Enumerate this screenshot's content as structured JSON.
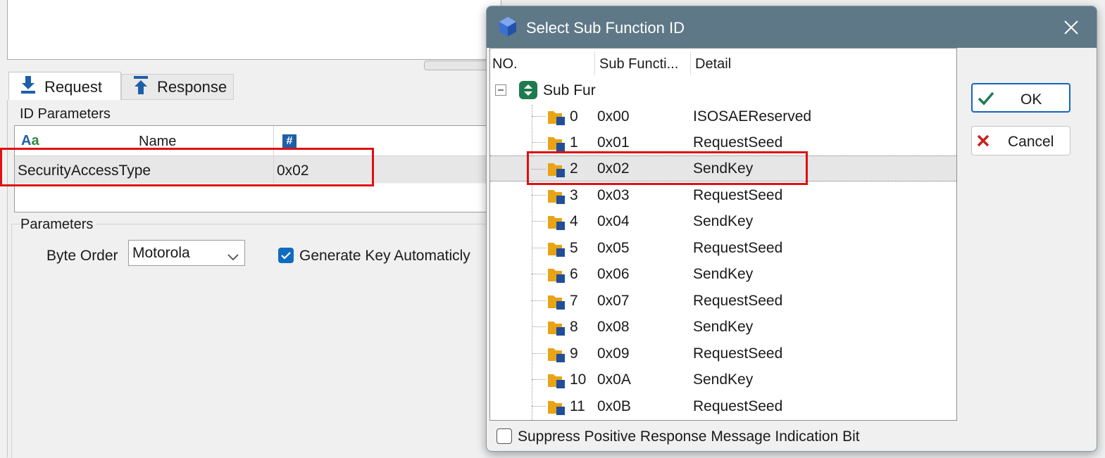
{
  "main": {
    "tabs": [
      {
        "label": "Request",
        "icon": "download-arrow-icon"
      },
      {
        "label": "Response",
        "icon": "upload-arrow-icon"
      }
    ],
    "id_parameters": {
      "title": "ID Parameters",
      "columns": [
        {
          "icon_text": "Aa",
          "label": "Name"
        },
        {
          "icon_text": "#",
          "label": ""
        }
      ],
      "rows": [
        {
          "name": "SecurityAccessType",
          "value": "0x02"
        }
      ]
    },
    "parameters": {
      "title": "Parameters",
      "byte_order_label": "Byte Order",
      "byte_order_value": "Motorola",
      "generate_key_label": "Generate Key Automaticly",
      "generate_key_checked": true
    }
  },
  "dialog": {
    "title": "Select Sub Function ID",
    "columns": [
      "NO.",
      "Sub Functi...",
      "Detail"
    ],
    "root_label": "Sub Fur",
    "items": [
      {
        "no": "0",
        "sub": "0x00",
        "detail": "ISOSAEReserved"
      },
      {
        "no": "1",
        "sub": "0x01",
        "detail": "RequestSeed"
      },
      {
        "no": "2",
        "sub": "0x02",
        "detail": "SendKey"
      },
      {
        "no": "3",
        "sub": "0x03",
        "detail": "RequestSeed"
      },
      {
        "no": "4",
        "sub": "0x04",
        "detail": "SendKey"
      },
      {
        "no": "5",
        "sub": "0x05",
        "detail": "RequestSeed"
      },
      {
        "no": "6",
        "sub": "0x06",
        "detail": "SendKey"
      },
      {
        "no": "7",
        "sub": "0x07",
        "detail": "RequestSeed"
      },
      {
        "no": "8",
        "sub": "0x08",
        "detail": "SendKey"
      },
      {
        "no": "9",
        "sub": "0x09",
        "detail": "RequestSeed"
      },
      {
        "no": "10",
        "sub": "0x0A",
        "detail": "SendKey"
      },
      {
        "no": "11",
        "sub": "0x0B",
        "detail": "RequestSeed"
      }
    ],
    "selected_index": 2,
    "ok_label": "OK",
    "cancel_label": "Cancel",
    "suppress_label": "Suppress Positive Response Message Indication Bit",
    "suppress_checked": false
  },
  "colors": {
    "titlebar": "#5f7887",
    "highlight_box": "#e01010",
    "checkbox_accent": "#0f6cbd",
    "folder": "#e8a317",
    "folder_badge": "#1f4e9a"
  }
}
